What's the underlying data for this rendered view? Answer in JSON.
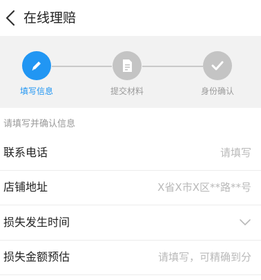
{
  "header": {
    "title": "在线理赔",
    "back_icon": "chevron-left-icon"
  },
  "steps": [
    {
      "label": "填写信息",
      "icon": "pencil-icon",
      "state": "active",
      "color": "#2196f3"
    },
    {
      "label": "提交材料",
      "icon": "document-icon",
      "state": "pending",
      "color": "#c4c4c4"
    },
    {
      "label": "身份确认",
      "icon": "check-icon",
      "state": "pending",
      "color": "#c4c4c4"
    }
  ],
  "form": {
    "hint": "请填写并确认信息",
    "rows": [
      {
        "label": "联系电话",
        "placeholder": "请填写"
      },
      {
        "label": "店铺地址",
        "placeholder": "X省X市X区**路**号"
      },
      {
        "label": "损失发生时间",
        "placeholder": ""
      },
      {
        "label": "损失金额预估",
        "placeholder": "请填写，可精确到分"
      }
    ]
  }
}
